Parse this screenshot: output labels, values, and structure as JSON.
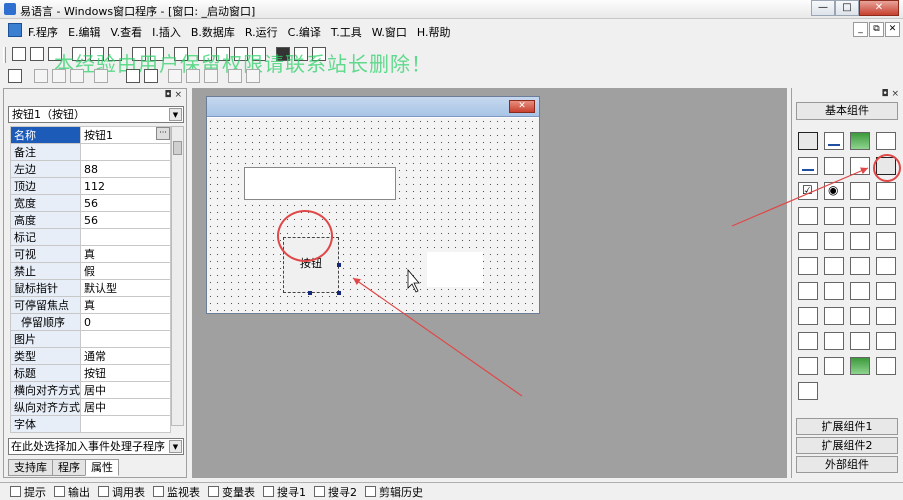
{
  "window": {
    "title": "易语言 - Windows窗口程序 - [窗口: _启动窗口]",
    "controls": {
      "minimize": "—",
      "maximize": "□",
      "close": "✕"
    }
  },
  "menubar": {
    "items": [
      "F.程序",
      "E.编辑",
      "V.查看",
      "I.插入",
      "B.数据库",
      "R.运行",
      "C.编译",
      "T.工具",
      "W.窗口",
      "H.帮助"
    ],
    "mdi_controls": [
      "_",
      "⧉",
      "✕"
    ]
  },
  "watermark": "本经验由用户保留权限请联系站长删除！",
  "property_panel": {
    "pin": "◘ ×",
    "object_selector": "按钮1（按钮）",
    "properties": [
      {
        "name": "名称",
        "value": "按钮1"
      },
      {
        "name": "备注",
        "value": ""
      },
      {
        "name": "左边",
        "value": "88"
      },
      {
        "name": "顶边",
        "value": "112"
      },
      {
        "name": "宽度",
        "value": "56"
      },
      {
        "name": "高度",
        "value": "56"
      },
      {
        "name": "标记",
        "value": ""
      },
      {
        "name": "可视",
        "value": "真"
      },
      {
        "name": "禁止",
        "value": "假"
      },
      {
        "name": "鼠标指针",
        "value": "默认型"
      },
      {
        "name": "可停留焦点",
        "value": "真"
      },
      {
        "name": "停留顺序",
        "value": "0"
      },
      {
        "name": "图片",
        "value": ""
      },
      {
        "name": "类型",
        "value": "通常"
      },
      {
        "name": "标题",
        "value": "按钮"
      },
      {
        "name": "横向对齐方式",
        "value": "居中"
      },
      {
        "name": "纵向对齐方式",
        "value": "居中"
      },
      {
        "name": "字体",
        "value": ""
      }
    ],
    "ellipsis": "···",
    "event_selector": "在此处选择加入事件处理子程序",
    "tabs": [
      "支持库",
      "程序",
      "属性"
    ]
  },
  "design_window": {
    "close": "✕",
    "button_caption": "按钮"
  },
  "toolbox": {
    "pin": "◘ ×",
    "header": "基本组件",
    "groups": [
      "扩展组件1",
      "扩展组件2",
      "外部组件"
    ]
  },
  "statusbar": {
    "items": [
      "提示",
      "输出",
      "调用表",
      "监视表",
      "变量表",
      "搜寻1",
      "搜寻2",
      "剪辑历史"
    ]
  },
  "annotation_color": "#e04747"
}
